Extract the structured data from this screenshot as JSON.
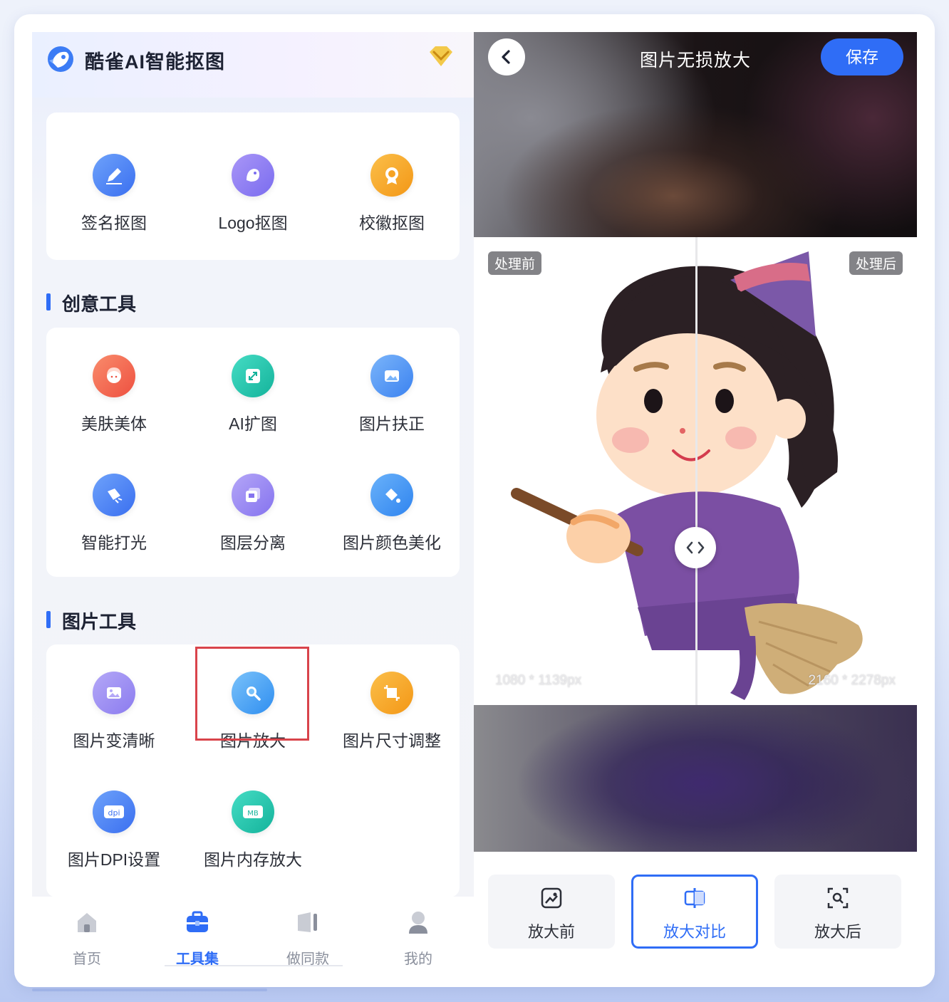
{
  "app": {
    "title": "酷雀AI智能抠图"
  },
  "top_tools": [
    {
      "label": "签名抠图",
      "icon": "pen-icon",
      "color": "#4f86f3"
    },
    {
      "label": "Logo抠图",
      "icon": "logo-icon",
      "color": "#8b7cf2"
    },
    {
      "label": "校徽抠图",
      "icon": "badge-icon",
      "color": "#f6a323"
    }
  ],
  "sections": [
    {
      "title": "创意工具",
      "tools": [
        {
          "label": "美肤美体",
          "icon": "face-icon",
          "color": "#f2674e"
        },
        {
          "label": "AI扩图",
          "icon": "expand-icon",
          "color": "#22c4ad"
        },
        {
          "label": "图片扶正",
          "icon": "picture-straighten-icon",
          "color": "#4f97f2"
        },
        {
          "label": "智能打光",
          "icon": "light-icon",
          "color": "#4f86f3"
        },
        {
          "label": "图层分离",
          "icon": "layers-icon",
          "color": "#9a86ef"
        },
        {
          "label": "图片颜色美化",
          "icon": "color-fill-icon",
          "color": "#3f96f3"
        }
      ]
    },
    {
      "title": "图片工具",
      "tools": [
        {
          "label": "图片变清晰",
          "icon": "image-clear-icon",
          "color": "#9a8af0"
        },
        {
          "label": "图片放大",
          "icon": "magnifier-icon",
          "color": "#4aa2f4"
        },
        {
          "label": "图片尺寸调整",
          "icon": "crop-icon",
          "color": "#f6a323"
        },
        {
          "label": "图片DPI设置",
          "icon": "dpi-icon",
          "color": "#4f86f3"
        },
        {
          "label": "图片内存放大",
          "icon": "mb-icon",
          "color": "#22c4ad"
        }
      ]
    }
  ],
  "bottom_nav": [
    {
      "label": "首页",
      "icon": "home-icon",
      "active": false
    },
    {
      "label": "工具集",
      "icon": "toolbox-icon",
      "active": true
    },
    {
      "label": "做同款",
      "icon": "template-icon",
      "active": false
    },
    {
      "label": "我的",
      "icon": "profile-icon",
      "active": false
    }
  ],
  "editor": {
    "title": "图片无损放大",
    "save_label": "保存",
    "before_tag": "处理前",
    "after_tag": "处理后",
    "before_size": "1080 * 1139px",
    "after_size": "2160 * 2278px",
    "modes": [
      {
        "label": "放大前",
        "icon": "image-icon",
        "active": false
      },
      {
        "label": "放大对比",
        "icon": "compare-icon",
        "active": true
      },
      {
        "label": "放大后",
        "icon": "zoom-search-icon",
        "active": false
      }
    ]
  },
  "colors": {
    "accent": "#2f6df6",
    "highlight_border": "#d9444b"
  }
}
